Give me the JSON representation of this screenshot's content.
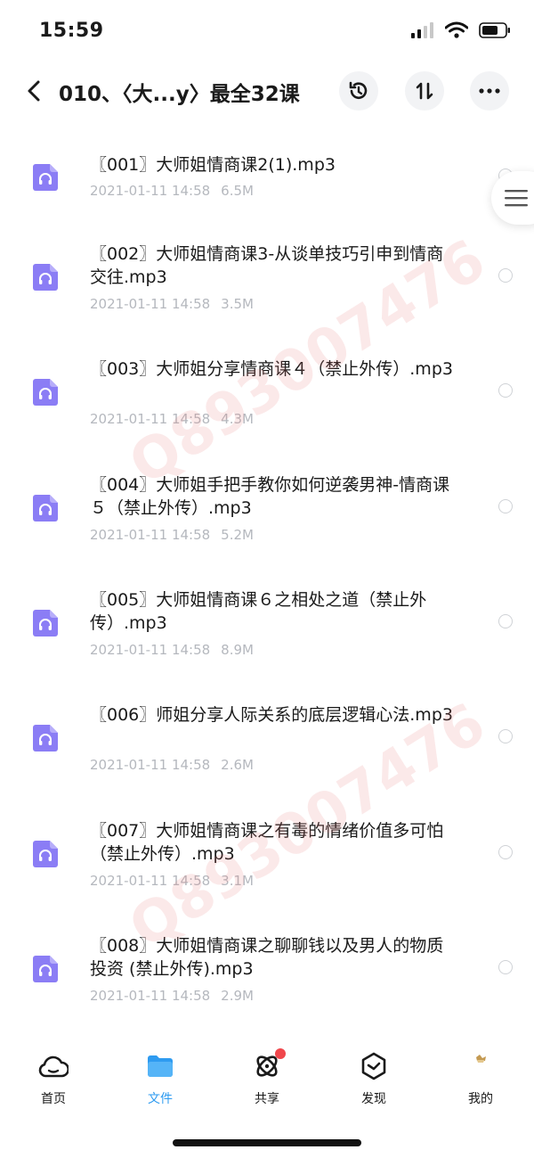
{
  "status": {
    "time": "15:59",
    "icons": [
      "signal-icon",
      "wifi-icon",
      "battery-icon"
    ]
  },
  "nav": {
    "title": "010、〈大...y〉最全32课",
    "buttons": [
      "history-icon",
      "sort-icon",
      "more-icon"
    ]
  },
  "files": [
    {
      "name": "〖001〗大师姐情商课2(1).mp3",
      "date": "2021-01-11 14:58",
      "size": "6.5M"
    },
    {
      "name": "〖002〗大师姐情商课3-从谈单技巧引申到情商交往.mp3",
      "date": "2021-01-11 14:58",
      "size": "3.5M"
    },
    {
      "name": "〖003〗大师姐分享情商课４（禁止外传）.mp3",
      "date": "2021-01-11 14:58",
      "size": "4.3M"
    },
    {
      "name": "〖004〗大师姐手把手教你如何逆袭男神-情商课５（禁止外传）.mp3",
      "date": "2021-01-11 14:58",
      "size": "5.2M"
    },
    {
      "name": "〖005〗大师姐情商课６之相处之道（禁止外传）.mp3",
      "date": "2021-01-11 14:58",
      "size": "8.9M"
    },
    {
      "name": "〖006〗师姐分享人际关系的底层逻辑心法.mp3",
      "date": "2021-01-11 14:58",
      "size": "2.6M"
    },
    {
      "name": "〖007〗大师姐情商课之有毒的情绪价值多可怕（禁止外传）.mp3",
      "date": "2021-01-11 14:58",
      "size": "3.1M"
    },
    {
      "name": "〖008〗大师姐情商课之聊聊钱以及男人的物质投资 (禁止外传).mp3",
      "date": "2021-01-11 14:58",
      "size": "2.9M"
    }
  ],
  "watermark": "Q893007476",
  "tabs": [
    {
      "label": "首页",
      "icon": "home-cloud-icon"
    },
    {
      "label": "文件",
      "icon": "folder-icon",
      "active": true
    },
    {
      "label": "共享",
      "icon": "share-orbit-icon",
      "badge": true
    },
    {
      "label": "发现",
      "icon": "discover-compass-icon"
    },
    {
      "label": "我的",
      "icon": "avatar-icon"
    }
  ],
  "colors": {
    "accent": "#2e9bf0",
    "file_icon": "#8b7df5",
    "meta_text": "#b5b8be",
    "badge": "#f0474c"
  }
}
